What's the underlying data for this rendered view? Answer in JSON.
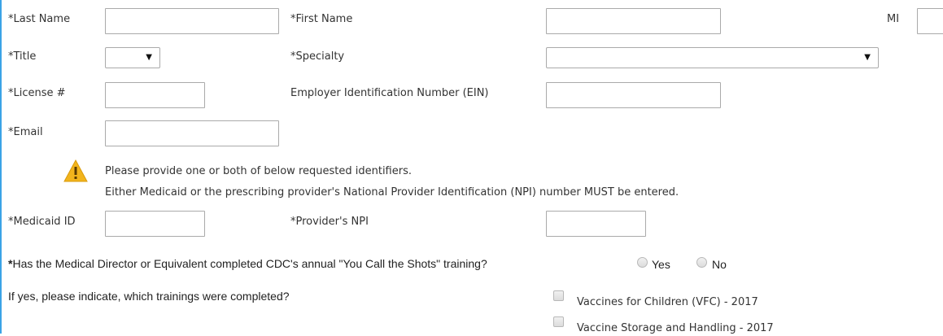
{
  "form": {
    "last_name_label": "*Last Name",
    "first_name_label": "*First Name",
    "mi_label": "MI",
    "title_label": "*Title",
    "title_value": "",
    "specialty_label": "*Specialty",
    "specialty_value": "",
    "license_label": "*License #",
    "ein_label": "Employer Identification Number (EIN)",
    "email_label": "*Email",
    "notice_line1": "Please provide one or both of below requested identifiers.",
    "notice_line2": "Either Medicaid or the prescribing provider's National Provider Identification (NPI) number MUST be entered.",
    "medicaid_label": "*Medicaid ID",
    "npi_label": "*Provider's NPI",
    "training_question_star": "*",
    "training_question": "Has the Medical Director or Equivalent completed CDC's annual \"You Call the Shots\" training?",
    "yes_label": "Yes",
    "no_label": "No",
    "trainings_question": "If yes, please indicate, which trainings were completed?",
    "trainings": [
      {
        "label": "Vaccines for Children (VFC) - 2017",
        "checked": false
      },
      {
        "label": "Vaccine Storage and Handling - 2017",
        "checked": false
      }
    ],
    "dropdown_caret": "▼"
  },
  "colors": {
    "accent_rule": "#3ba3e6",
    "warning": "#f2b41c"
  }
}
